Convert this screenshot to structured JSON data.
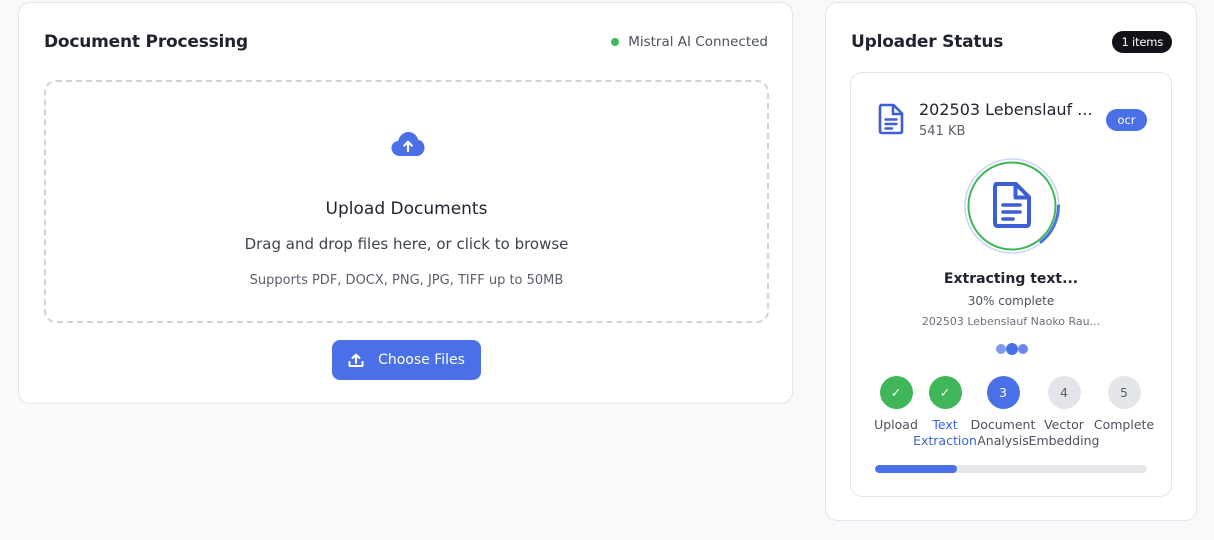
{
  "document_processing": {
    "title": "Document Processing",
    "connection_status": "Mistral AI Connected",
    "connection_color": "#3fb657",
    "dropzone": {
      "icon": "cloud-upload-icon",
      "title": "Upload Documents",
      "subtitle": "Drag and drop files here, or click to browse",
      "note": "Supports PDF, DOCX, PNG, JPG, TIFF up to 50MB"
    },
    "choose_button": {
      "icon": "upload-icon",
      "label": "Choose Files"
    }
  },
  "uploader_status": {
    "title": "Uploader Status",
    "items_badge": "1 items",
    "file": {
      "icon": "document-icon",
      "name": "202503 Lebenslauf ...",
      "size": "541 KB",
      "badge": "ocr",
      "stage_title": "Extracting text...",
      "stage_percent": "30% complete",
      "stage_file": "202503 Lebenslauf Naoko Rau...",
      "progress": 0.3,
      "steps": [
        {
          "number": "✓",
          "label_line1": "Upload",
          "label_line2": "",
          "state": "done"
        },
        {
          "number": "✓",
          "label_line1": "Text",
          "label_line2": "Extraction",
          "state": "done"
        },
        {
          "number": "3",
          "label_line1": "Document",
          "label_line2": "Analysis",
          "state": "active"
        },
        {
          "number": "4",
          "label_line1": "Vector",
          "label_line2": "Embedding",
          "state": "pending"
        },
        {
          "number": "5",
          "label_line1": "Complete",
          "label_line2": "",
          "state": "pending"
        }
      ]
    }
  },
  "colors": {
    "accent": "#4a70e8",
    "success": "#3fb657",
    "pending": "#e3e5ea"
  }
}
